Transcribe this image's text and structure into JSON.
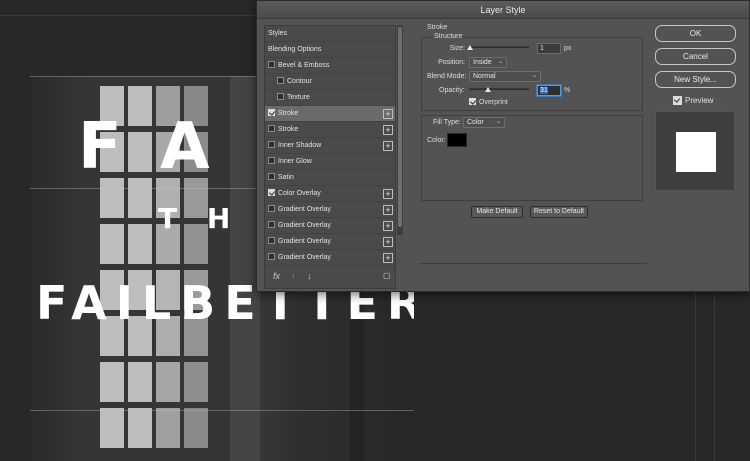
{
  "canvas": {
    "text_line1": "F  A",
    "text_line2": "T H E",
    "text_line3": "FAILBETTER"
  },
  "dialog": {
    "title": "Layer Style",
    "styles_list": [
      {
        "label": "Styles",
        "checkbox": false,
        "checked": false,
        "plus": false,
        "indent": false,
        "selected": false
      },
      {
        "label": "Blending Options",
        "checkbox": false,
        "checked": false,
        "plus": false,
        "indent": false,
        "selected": false
      },
      {
        "label": "Bevel & Emboss",
        "checkbox": true,
        "checked": false,
        "plus": false,
        "indent": false,
        "selected": false
      },
      {
        "label": "Contour",
        "checkbox": true,
        "checked": false,
        "plus": false,
        "indent": true,
        "selected": false
      },
      {
        "label": "Texture",
        "checkbox": true,
        "checked": false,
        "plus": false,
        "indent": true,
        "selected": false
      },
      {
        "label": "Stroke",
        "checkbox": true,
        "checked": true,
        "plus": true,
        "indent": false,
        "selected": true
      },
      {
        "label": "Stroke",
        "checkbox": true,
        "checked": false,
        "plus": true,
        "indent": false,
        "selected": false
      },
      {
        "label": "Inner Shadow",
        "checkbox": true,
        "checked": false,
        "plus": true,
        "indent": false,
        "selected": false
      },
      {
        "label": "Inner Glow",
        "checkbox": true,
        "checked": false,
        "plus": false,
        "indent": false,
        "selected": false
      },
      {
        "label": "Satin",
        "checkbox": true,
        "checked": false,
        "plus": false,
        "indent": false,
        "selected": false
      },
      {
        "label": "Color Overlay",
        "checkbox": true,
        "checked": true,
        "plus": true,
        "indent": false,
        "selected": false
      },
      {
        "label": "Gradient Overlay",
        "checkbox": true,
        "checked": false,
        "plus": true,
        "indent": false,
        "selected": false
      },
      {
        "label": "Gradient Overlay",
        "checkbox": true,
        "checked": false,
        "plus": true,
        "indent": false,
        "selected": false
      },
      {
        "label": "Gradient Overlay",
        "checkbox": true,
        "checked": false,
        "plus": true,
        "indent": false,
        "selected": false
      },
      {
        "label": "Gradient Overlay",
        "checkbox": true,
        "checked": false,
        "plus": true,
        "indent": false,
        "selected": false
      }
    ],
    "footer_icons": {
      "fx": "fx",
      "up": "↑",
      "down": "↓",
      "trash": "🗑"
    },
    "stroke": {
      "section_title": "Stroke",
      "structure_title": "Structure",
      "size_label": "Size:",
      "size_value": "1",
      "size_unit": "px",
      "size_fraction": 0.01,
      "position_label": "Position:",
      "position_value": "Inside",
      "blend_label": "Blend Mode:",
      "blend_value": "Normal",
      "opacity_label": "Opacity:",
      "opacity_value": "31",
      "opacity_unit": "%",
      "opacity_fraction": 0.31,
      "overprint_label": "Overprint",
      "overprint_checked": true,
      "fill_type_label": "Fill Type:",
      "fill_type_value": "Color",
      "color_label": "Color:",
      "color_value": "#000000",
      "make_default": "Make Default",
      "reset_default": "Reset to Default"
    },
    "buttons": {
      "ok": "OK",
      "cancel": "Cancel",
      "new_style": "New Style..."
    },
    "preview": {
      "label": "Preview",
      "checked": true,
      "swatch_color": "#ffffff"
    }
  }
}
